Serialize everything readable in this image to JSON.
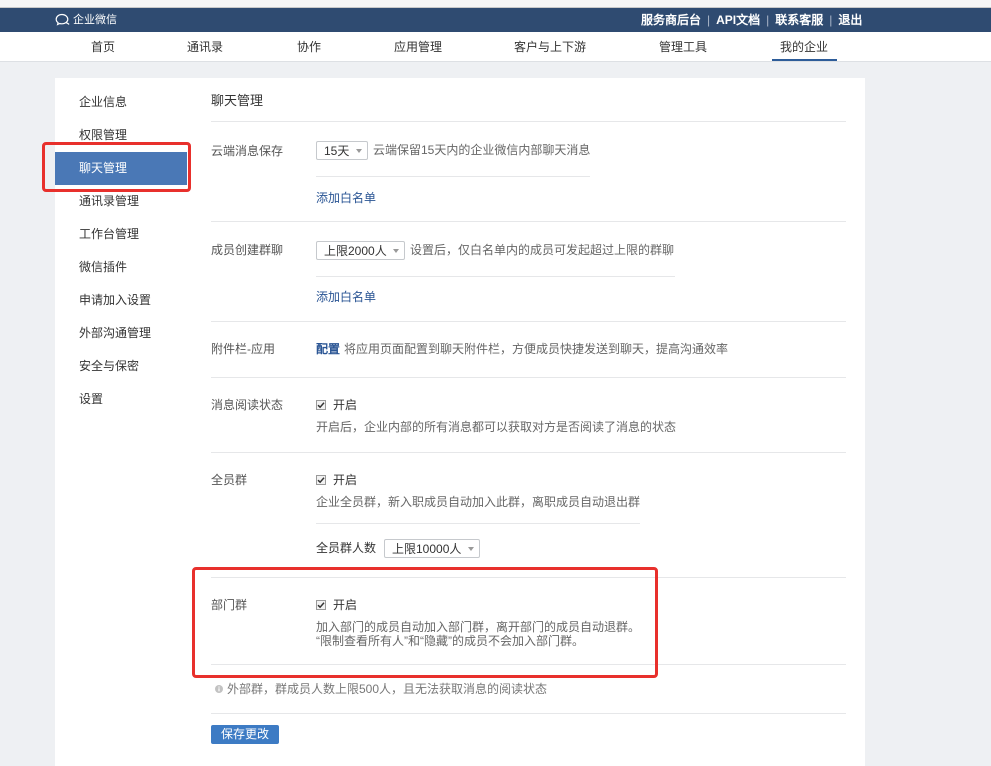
{
  "colors": {
    "header_bg": "#2f4b71",
    "accent": "#3d7bc4",
    "sidebar_active": "#4a78b6",
    "link": "#2a5594",
    "highlight": "#e8302c",
    "page_bg": "#eef0f3"
  },
  "icons": {
    "logo": "chat-bubbles-icon",
    "select_caret": "chevron-down-icon",
    "checkbox": "checkbox-checked-icon",
    "note": "info-icon"
  },
  "header": {
    "logo_text": "企业微信",
    "separator": "|",
    "links": [
      {
        "label": "服务商后台"
      },
      {
        "label": "API文档"
      },
      {
        "label": "联系客服"
      },
      {
        "label": "退出"
      }
    ]
  },
  "nav": {
    "items": [
      {
        "label": "首页"
      },
      {
        "label": "通讯录"
      },
      {
        "label": "协作"
      },
      {
        "label": "应用管理"
      },
      {
        "label": "客户与上下游"
      },
      {
        "label": "管理工具"
      },
      {
        "label": "我的企业",
        "active": true
      }
    ]
  },
  "sidebar": {
    "items": [
      {
        "label": "企业信息"
      },
      {
        "label": "权限管理"
      },
      {
        "label": "聊天管理",
        "active": true
      },
      {
        "label": "通讯录管理"
      },
      {
        "label": "工作台管理"
      },
      {
        "label": "微信插件"
      },
      {
        "label": "申请加入设置"
      },
      {
        "label": "外部沟通管理"
      },
      {
        "label": "安全与保密"
      },
      {
        "label": "设置"
      }
    ]
  },
  "settings": {
    "title": "聊天管理",
    "cloud_message_retention": {
      "label": "云端消息保存",
      "selected": "15天",
      "description": "云端保留15天内的企业微信内部聊天消息",
      "whitelist_link": "添加白名单"
    },
    "member_group_creation": {
      "label": "成员创建群聊",
      "selected": "上限2000人",
      "description": "设置后，仅白名单内的成员可发起超过上限的群聊",
      "whitelist_link": "添加白名单"
    },
    "attachment_bar_apps": {
      "label": "附件栏-应用",
      "config_link": "配置",
      "description": "将应用页面配置到聊天附件栏，方便成员快捷发送到聊天，提高沟通效率"
    },
    "read_status": {
      "label": "消息阅读状态",
      "checked": true,
      "checkbox_label": "开启",
      "description": "开启后，企业内部的所有消息都可以获取对方是否阅读了消息的状态"
    },
    "all_staff_group": {
      "label": "全员群",
      "checked": true,
      "checkbox_label": "开启",
      "description": "企业全员群，新入职成员自动加入此群，离职成员自动退出群",
      "size_label": "全员群人数",
      "size_selected": "上限10000人"
    },
    "department_group": {
      "label": "部门群",
      "checked": true,
      "checkbox_label": "开启",
      "description_lines": [
        "加入部门的成员自动加入部门群，离开部门的成员自动退群。",
        "“限制查看所有人”和“隐藏”的成员不会加入部门群。"
      ]
    },
    "note": "外部群，群成员人数上限500人，且无法获取消息的阅读状态",
    "save_button": "保存更改"
  }
}
